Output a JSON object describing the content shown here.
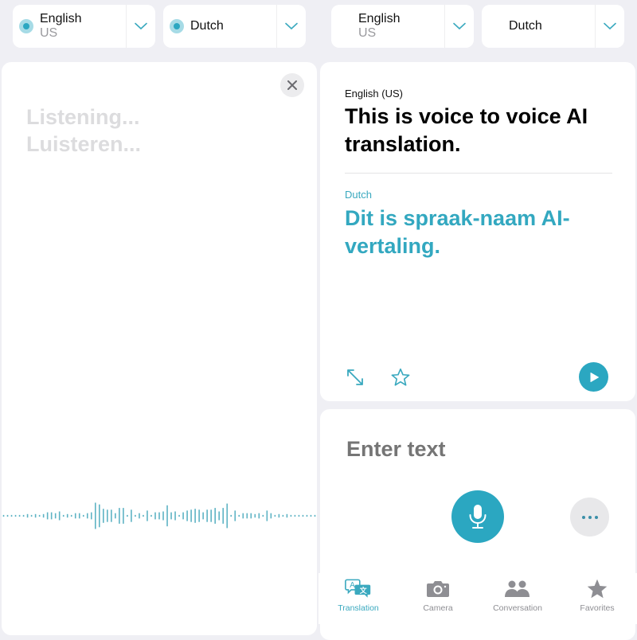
{
  "left_screen": {
    "source_language": {
      "name": "English",
      "region": "US"
    },
    "target_language": {
      "name": "Dutch"
    },
    "listening": {
      "line1": "Listening...",
      "line2": "Luisteren..."
    },
    "waveform_levels": [
      0.05,
      0.05,
      0.05,
      0.05,
      0.05,
      0.05,
      0.1,
      0.05,
      0.1,
      0.05,
      0.1,
      0.2,
      0.2,
      0.15,
      0.25,
      0.05,
      0.1,
      0.05,
      0.15,
      0.15,
      0.05,
      0.15,
      0.2,
      0.75,
      0.65,
      0.4,
      0.35,
      0.35,
      0.15,
      0.45,
      0.45,
      0.05,
      0.35,
      0.05,
      0.15,
      0.05,
      0.3,
      0.05,
      0.2,
      0.2,
      0.25,
      0.6,
      0.2,
      0.25,
      0.05,
      0.2,
      0.3,
      0.35,
      0.4,
      0.35,
      0.2,
      0.35,
      0.35,
      0.45,
      0.25,
      0.45,
      0.7,
      0.05,
      0.3,
      0.05,
      0.15,
      0.15,
      0.15,
      0.1,
      0.15,
      0.05,
      0.3,
      0.15,
      0.05,
      0.1,
      0.05,
      0.1,
      0.05,
      0.05,
      0.05,
      0.05,
      0.05,
      0.05,
      0.05
    ]
  },
  "right_screen": {
    "source_language": {
      "name": "English",
      "region": "US"
    },
    "target_language": {
      "name": "Dutch"
    },
    "result": {
      "source_label": "English (US)",
      "source_text": "This is voice to voice AI translation.",
      "target_label": "Dutch",
      "target_text": "Dit is spraak-naam AI-vertaling."
    },
    "input": {
      "placeholder": "Enter text"
    },
    "tabs": [
      {
        "label": "Translation",
        "icon": "translate-icon",
        "active": true
      },
      {
        "label": "Camera",
        "icon": "camera-icon",
        "active": false
      },
      {
        "label": "Conversation",
        "icon": "conversation-icon",
        "active": false
      },
      {
        "label": "Favorites",
        "icon": "star-filled-icon",
        "active": false
      }
    ]
  },
  "colors": {
    "accent": "#2ba7c1",
    "accent_text": "#33a8c0",
    "background": "#efeff4",
    "placeholder": "#dcdcde",
    "inactive_tab": "#8e8e93"
  }
}
